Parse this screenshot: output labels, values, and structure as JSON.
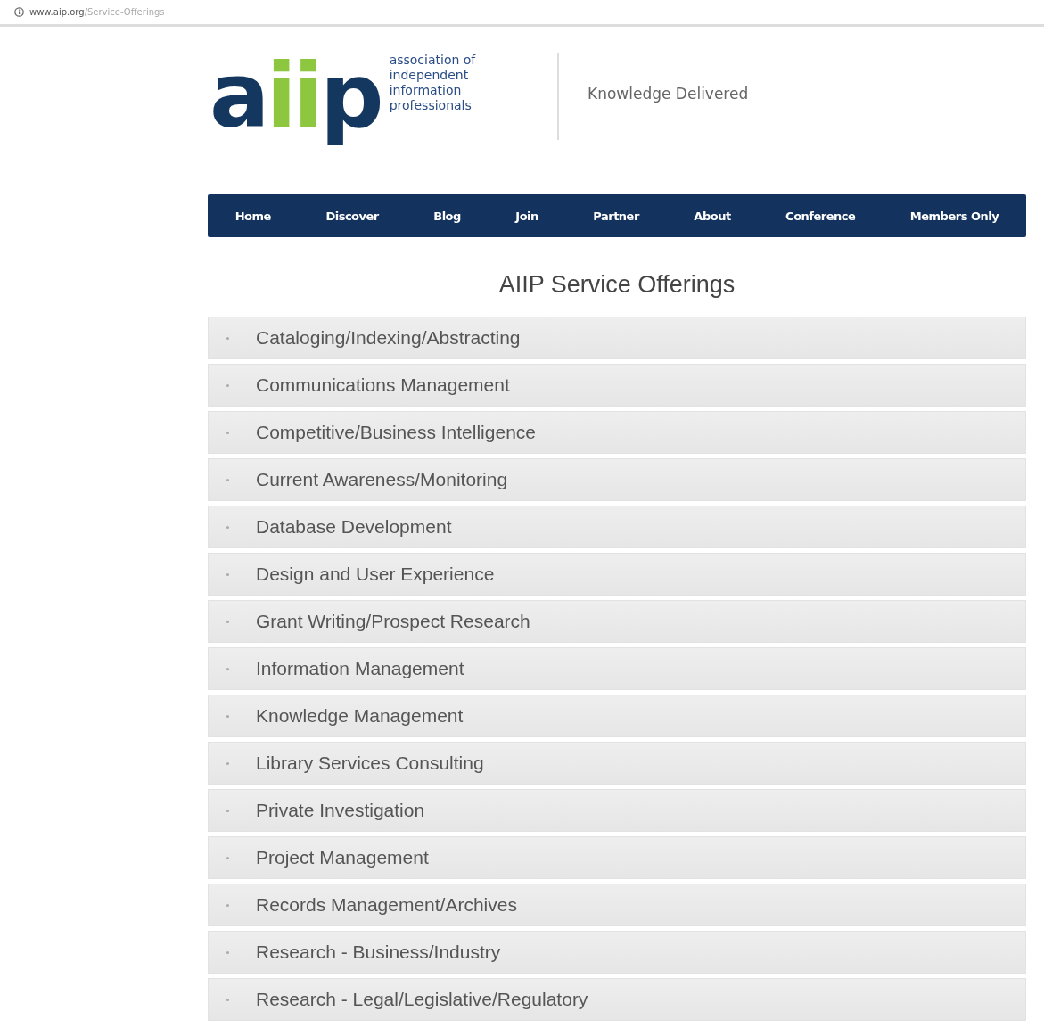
{
  "address_bar": {
    "domain": "www.aip.org",
    "path": "/Service-Offerings"
  },
  "logo": {
    "letters": [
      {
        "text": "a",
        "color": "#13375e"
      },
      {
        "text": "ii",
        "color": "#8dc63f"
      },
      {
        "text": "p",
        "color": "#13375e"
      }
    ],
    "lines": [
      "association of",
      "independent",
      "information",
      "professionals"
    ]
  },
  "tagline": "Knowledge Delivered",
  "nav": [
    {
      "label": "Home"
    },
    {
      "label": "Discover"
    },
    {
      "label": "Blog"
    },
    {
      "label": "Join"
    },
    {
      "label": "Partner"
    },
    {
      "label": "About"
    },
    {
      "label": "Conference"
    },
    {
      "label": "Members Only"
    }
  ],
  "page_title": "AIIP Service Offerings",
  "services": [
    {
      "label": "Cataloging/Indexing/Abstracting",
      "expanded": false
    },
    {
      "label": "Communications Management",
      "expanded": false
    },
    {
      "label": "Competitive/Business Intelligence",
      "expanded": false
    },
    {
      "label": "Current Awareness/Monitoring",
      "expanded": false
    },
    {
      "label": "Database Development",
      "expanded": false
    },
    {
      "label": "Design and User Experience",
      "expanded": false
    },
    {
      "label": "Grant Writing/Prospect Research",
      "expanded": false
    },
    {
      "label": "Information Management",
      "expanded": false
    },
    {
      "label": "Knowledge Management",
      "expanded": false
    },
    {
      "label": "Library Services Consulting",
      "expanded": false
    },
    {
      "label": "Private Investigation",
      "expanded": false
    },
    {
      "label": "Project Management",
      "expanded": false
    },
    {
      "label": "Records Management/Archives",
      "expanded": false
    },
    {
      "label": "Research - Business/Industry",
      "expanded": false
    },
    {
      "label": "Research - Legal/Legislative/Regulatory",
      "expanded": false
    }
  ]
}
